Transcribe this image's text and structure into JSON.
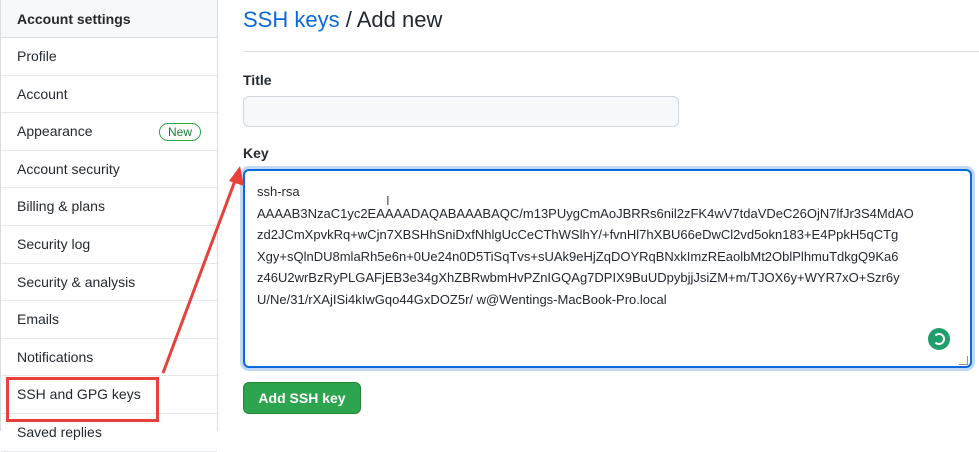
{
  "sidebar": {
    "header": "Account settings",
    "items": [
      {
        "label": "Profile"
      },
      {
        "label": "Account"
      },
      {
        "label": "Appearance",
        "badge": "New"
      },
      {
        "label": "Account security"
      },
      {
        "label": "Billing & plans"
      },
      {
        "label": "Security log"
      },
      {
        "label": "Security & analysis"
      },
      {
        "label": "Emails"
      },
      {
        "label": "Notifications"
      },
      {
        "label": "SSH and GPG keys"
      },
      {
        "label": "Saved replies"
      }
    ]
  },
  "breadcrumb": {
    "link": "SSH keys",
    "separator": "/",
    "current": "Add new"
  },
  "form": {
    "title_label": "Title",
    "title_value": "",
    "key_label": "Key",
    "key_lines": [
      "ssh-rsa",
      "AAAAB3NzaC1yc2EAAAADAQABAAABAQC/m13PUygCmAoJBRRs6nil2zFK4wV7tdaVDeC26OjN7lfJr3S4MdAO",
      "zd2JCmXpvkRq+wCjn7XBSHhSniDxfNhlgUcCeCThWSlhY/+fvnHl7hXBU66eDwCl2vd5okn183+E4PpkH5qCTg",
      "Xgy+sQlnDU8mlaRh5e6n+0Ue24n0D5TiSqTvs+sUAk9eHjZqDOYRqBNxkImzREaolbMt2OblPlhmuTdkgQ9Ka6",
      "z46U2wrBzRyPLGAFjEB3e34gXhZBRwbmHvPZnIGQAg7DPIX9BuUDpybjjJsiZM+m/TJOX6y+WYR7xO+Szr6y",
      "U/Ne/31/rXAjISi4kIwGqo44GxDOZ5r/ w@Wentings-MacBook-Pro.local"
    ],
    "submit_label": "Add SSH key"
  },
  "colors": {
    "accent": "#0969da",
    "button": "#2da44e",
    "annotation": "#e8403a"
  }
}
